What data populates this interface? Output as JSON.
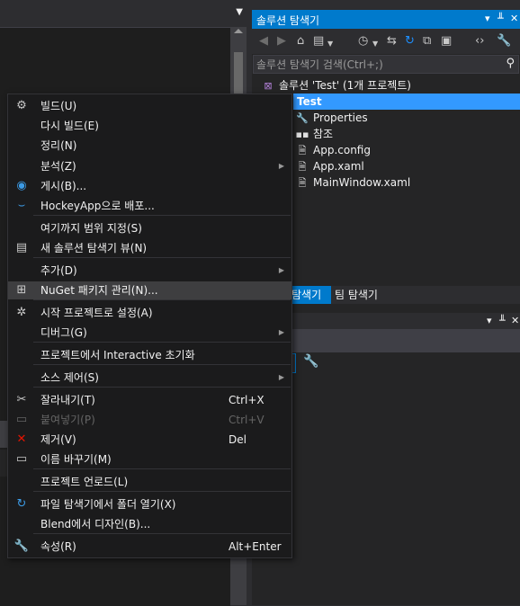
{
  "solution_explorer": {
    "title": "솔루션 탐색기",
    "pin_glyph": "▾ ╨ ✕",
    "search_placeholder": "솔루션 탐색기 검색(Ctrl+;)",
    "solution_label": "솔루션 'Test' (1개 프로젝트)",
    "project_label": "Test",
    "children": [
      {
        "label": "Properties",
        "icon": "wrench-icon"
      },
      {
        "label": "참조",
        "icon": "references-icon"
      },
      {
        "label": "App.config",
        "icon": "config-file-icon"
      },
      {
        "label": "App.xaml",
        "icon": "xaml-file-icon"
      },
      {
        "label": "MainWindow.xaml",
        "icon": "xaml-file-icon"
      }
    ],
    "tab_active": "탐색기",
    "tab_team": "팀 탐색기"
  },
  "properties_pane": {
    "title_controls": "▾ ╨ ✕"
  },
  "context_menu": {
    "items": [
      {
        "label": "빌드(U)",
        "shortcut": "",
        "icon": "build-icon",
        "submenu": false,
        "disabled": false
      },
      {
        "label": "다시 빌드(E)",
        "shortcut": "",
        "icon": "",
        "submenu": false,
        "disabled": false
      },
      {
        "label": "정리(N)",
        "shortcut": "",
        "icon": "",
        "submenu": false,
        "disabled": false
      },
      {
        "label": "분석(Z)",
        "shortcut": "",
        "icon": "",
        "submenu": true,
        "disabled": false
      },
      {
        "label": "게시(B)...",
        "shortcut": "",
        "icon": "globe-icon",
        "submenu": false,
        "disabled": false
      },
      {
        "label": "HockeyApp으로 배포...",
        "shortcut": "",
        "icon": "hockeyapp-icon",
        "submenu": false,
        "disabled": false
      },
      {
        "label": "여기까지 범위 지정(S)",
        "shortcut": "",
        "icon": "",
        "submenu": false,
        "disabled": false
      },
      {
        "label": "새 솔루션 탐색기 뷰(N)",
        "shortcut": "",
        "icon": "new-view-icon",
        "submenu": false,
        "disabled": false
      },
      {
        "label": "추가(D)",
        "shortcut": "",
        "icon": "",
        "submenu": true,
        "disabled": false
      },
      {
        "label": "NuGet 패키지 관리(N)...",
        "shortcut": "",
        "icon": "nuget-icon",
        "submenu": false,
        "disabled": false
      },
      {
        "label": "시작 프로젝트로 설정(A)",
        "shortcut": "",
        "icon": "gear-icon",
        "submenu": false,
        "disabled": false
      },
      {
        "label": "디버그(G)",
        "shortcut": "",
        "icon": "",
        "submenu": true,
        "disabled": false
      },
      {
        "label": "프로젝트에서 Interactive 초기화",
        "shortcut": "",
        "icon": "",
        "submenu": false,
        "disabled": false
      },
      {
        "label": "소스 제어(S)",
        "shortcut": "",
        "icon": "",
        "submenu": true,
        "disabled": false
      },
      {
        "label": "잘라내기(T)",
        "shortcut": "Ctrl+X",
        "icon": "scissors-icon",
        "submenu": false,
        "disabled": false
      },
      {
        "label": "붙여넣기(P)",
        "shortcut": "Ctrl+V",
        "icon": "paste-icon",
        "submenu": false,
        "disabled": true
      },
      {
        "label": "제거(V)",
        "shortcut": "Del",
        "icon": "delete-icon",
        "submenu": false,
        "disabled": false
      },
      {
        "label": "이름 바꾸기(M)",
        "shortcut": "",
        "icon": "rename-icon",
        "submenu": false,
        "disabled": false
      },
      {
        "label": "프로젝트 언로드(L)",
        "shortcut": "",
        "icon": "",
        "submenu": false,
        "disabled": false
      },
      {
        "label": "파일 탐색기에서 폴더 열기(X)",
        "shortcut": "",
        "icon": "refresh-arrow-icon",
        "submenu": false,
        "disabled": false
      },
      {
        "label": "Blend에서 디자인(B)...",
        "shortcut": "",
        "icon": "",
        "submenu": false,
        "disabled": false
      },
      {
        "label": "속성(R)",
        "shortcut": "Alt+Enter",
        "icon": "wrench-icon",
        "submenu": false,
        "disabled": false
      }
    ],
    "highlighted_index": 9
  },
  "colors": {
    "accent": "#007acc",
    "selection": "#3399ff",
    "menu_bg": "#1b1b1c",
    "delete_red": "#e51400"
  }
}
